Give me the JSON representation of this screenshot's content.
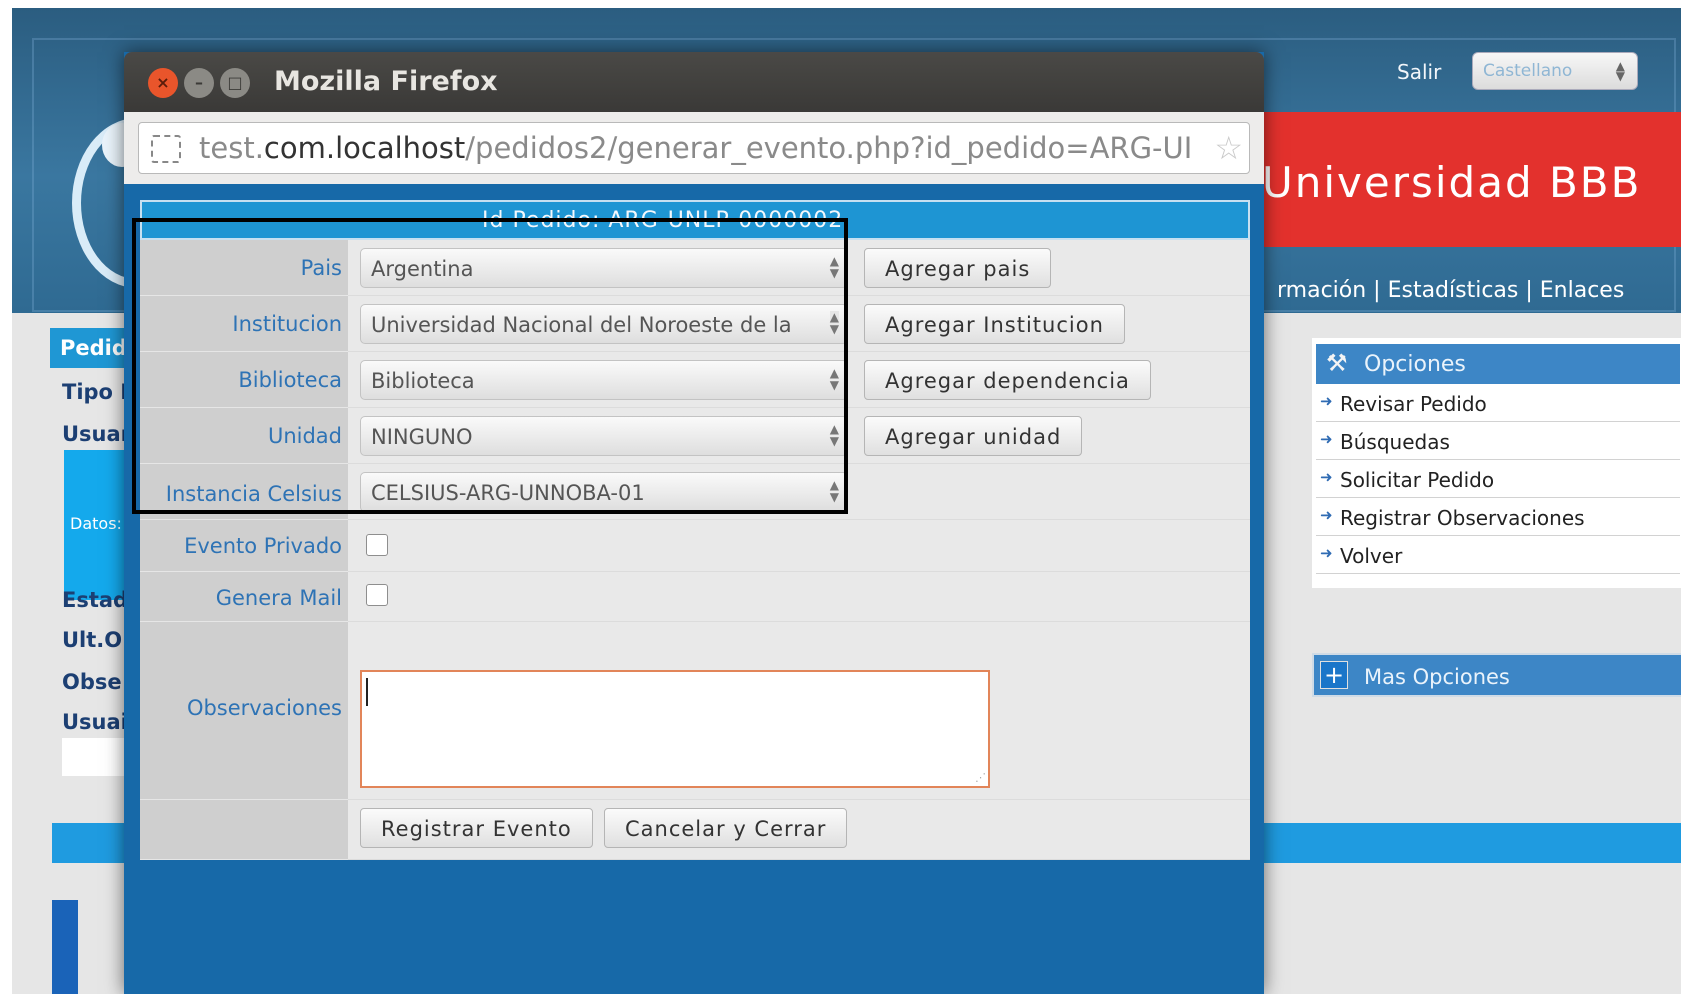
{
  "background": {
    "header": {
      "salir": "Salir",
      "language": "Castellano",
      "brand": "Universidad BBB",
      "nav": "rmación | Estadísticas | Enlaces"
    },
    "left_labels": {
      "pedido": "Pedid",
      "tipo": "Tipo P",
      "usuario": "Usuar",
      "datos": "Datos:",
      "estado": "Estad",
      "ult": "Ult.O",
      "obs": "Obse",
      "usuario2": "Usuai"
    },
    "options_panel": {
      "title": "Opciones",
      "items": [
        {
          "label": "Revisar Pedido"
        },
        {
          "label": "Búsquedas"
        },
        {
          "label": "Solicitar Pedido"
        },
        {
          "label": "Registrar Observaciones"
        },
        {
          "label": "Volver"
        }
      ],
      "more": "Mas Opciones"
    }
  },
  "window": {
    "title": "Mozilla Firefox",
    "url_prefix": "test.",
    "url_domain": "com.localhost",
    "url_path": "/pedidos2/generar_evento.php?id_pedido=ARG-UI"
  },
  "form": {
    "id_label": "Id Pedido:  ARG-UNLP-0000002",
    "rows": {
      "pais": {
        "label": "Pais",
        "value": "Argentina",
        "button": "Agregar pais"
      },
      "institucion": {
        "label": "Institucion",
        "value": "Universidad Nacional del Noroeste de la",
        "button": "Agregar Institucion"
      },
      "biblioteca": {
        "label": "Biblioteca",
        "value": "Biblioteca",
        "button": "Agregar dependencia"
      },
      "unidad": {
        "label": "Unidad",
        "value": "NINGUNO",
        "button": "Agregar unidad"
      },
      "instancia": {
        "label": "Instancia Celsius",
        "value": "CELSIUS-ARG-UNNOBA-01"
      }
    },
    "evento_privado": {
      "label": "Evento Privado",
      "checked": false
    },
    "genera_mail": {
      "label": "Genera Mail",
      "checked": false
    },
    "observaciones": {
      "label": "Observaciones",
      "value": ""
    },
    "buttons": {
      "registrar": "Registrar Evento",
      "cancelar": "Cancelar y Cerrar"
    }
  },
  "colors": {
    "brand_red": "#e3312d",
    "header_blue": "#2f6a92",
    "label_blue": "#2e73b5",
    "title_bar": "#3a3937"
  }
}
